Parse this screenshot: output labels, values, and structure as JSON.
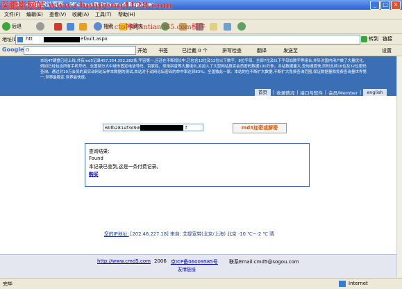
{
  "window": {
    "title": "MD5 - 首页默认页面 - Microsoft Internet Explorer",
    "watermark": "深鹏影网站 www.chenpeng4128.com",
    "watermark2": "www.chenpeng4128.com"
  },
  "menu": [
    "文件(F)",
    "编辑(E)",
    "查看(V)",
    "收藏(A)",
    "工具(T)",
    "帮助(H)"
  ],
  "toolbar": {
    "back": "后退",
    "search": "搜索",
    "favorites": "收藏夹",
    "watermark": "51cto特约antian365.com稿件"
  },
  "address": {
    "label": "地址(D)",
    "url_prefix": "htt",
    "url_suffix": "efault.aspx",
    "go_label": "转到",
    "links_label": "链接"
  },
  "google_bar": {
    "brand": "Google",
    "field_value": "G",
    "items": [
      "开始",
      "书签",
      "已拦截 0 个",
      "拼写检查",
      "翻译",
      "发送至"
    ],
    "settings": "设置"
  },
  "site_header": {
    "description": "本站4T硬盘已经上线,共有md5记录457,354,352,282条,宇宙第一,且还在不断增长中,已包含12位及12位以下数字、8位字母、全部7位及以下字母加数字等组合,并针对国内用户做了大量优化,例如已经包含所有手机号码、全国部分大中城市固定电话号码、百家姓、常用拼音等大量组合,另加入了大型网站真实会员密码数据100万条。本站数据量大,查询速度快,同时支持16位及32位密码查询。通过对10万会员的真实动网论坛样本数据的测试,本站对于动网论坛密码的命中率达到83%。全国独此一家。本站的在不断扩大数据,不断扩大免费查询范围,保证数据量和免费查询量世界第一,世界最稳定,世界最快速。",
    "nav": [
      "首页",
      "收录情况",
      "接口与软件",
      "会员/Member",
      "english"
    ]
  },
  "search": {
    "input_prefix": "6bfb281ef3d9d6b8",
    "input_suffix": "f",
    "button": "md5加密或解密"
  },
  "result": {
    "heading": "查询结果:",
    "status": "Found",
    "message": "本记录已查到,这是一条付费记录。",
    "buy_link": "购买"
  },
  "ip_info": {
    "prefix": "您的IP地址:",
    "text": "[202.46.227.18] 来自: 艾提宽带(北京/上海) 北京 -10 ℃~-2 ℃ 晴"
  },
  "footer": {
    "site_link": "http://www.cmd5.com",
    "year": "2006",
    "icp": "京ICP备06009585号",
    "contact": "联系Email:cmd5@sogou.com",
    "friend_links": "友情链接"
  },
  "status": {
    "left": "完毕",
    "zone": "Internet"
  }
}
